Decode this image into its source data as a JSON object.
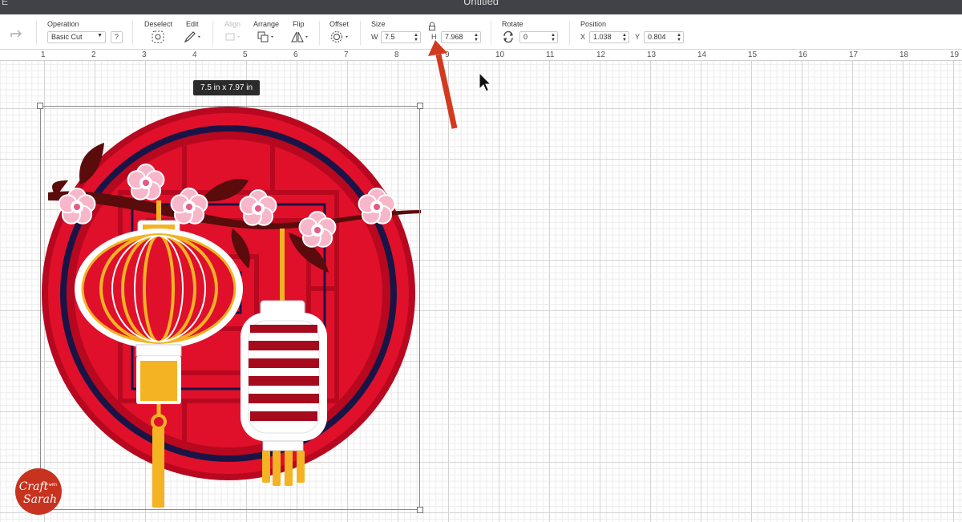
{
  "window": {
    "title": "Untitled",
    "left_fragment": "E"
  },
  "toolbar": {
    "operation": {
      "label": "Operation",
      "value": "Basic Cut",
      "help": "?"
    },
    "deselect_label": "Deselect",
    "edit_label": "Edit",
    "align_label": "Align",
    "arrange_label": "Arrange",
    "flip_label": "Flip",
    "offset_label": "Offset",
    "size": {
      "label": "Size",
      "w_label": "W",
      "w_value": "7.5",
      "h_label": "H",
      "h_value": "7.968"
    },
    "rotate": {
      "label": "Rotate",
      "value": "0"
    },
    "position": {
      "label": "Position",
      "x_label": "X",
      "x_value": "1.038",
      "y_label": "Y",
      "y_value": "0.804"
    }
  },
  "ruler": {
    "marks": [
      "1",
      "2",
      "3",
      "4",
      "5",
      "6",
      "7",
      "8",
      "9",
      "10",
      "11",
      "12",
      "13",
      "14",
      "15",
      "16",
      "17",
      "18",
      "19"
    ]
  },
  "canvas": {
    "size_tooltip": "7.5  in x 7.97  in"
  },
  "watermark": {
    "line1": "Craft",
    "line2": "with",
    "line3": "Sarah"
  },
  "colors": {
    "accent_red": "#e0102b",
    "navy": "#1a1446",
    "dark_red": "#b8081f",
    "gold": "#f4b323",
    "pink": "#f7b6c9",
    "branch": "#5a0b0b",
    "arrow": "#d23a1f"
  }
}
